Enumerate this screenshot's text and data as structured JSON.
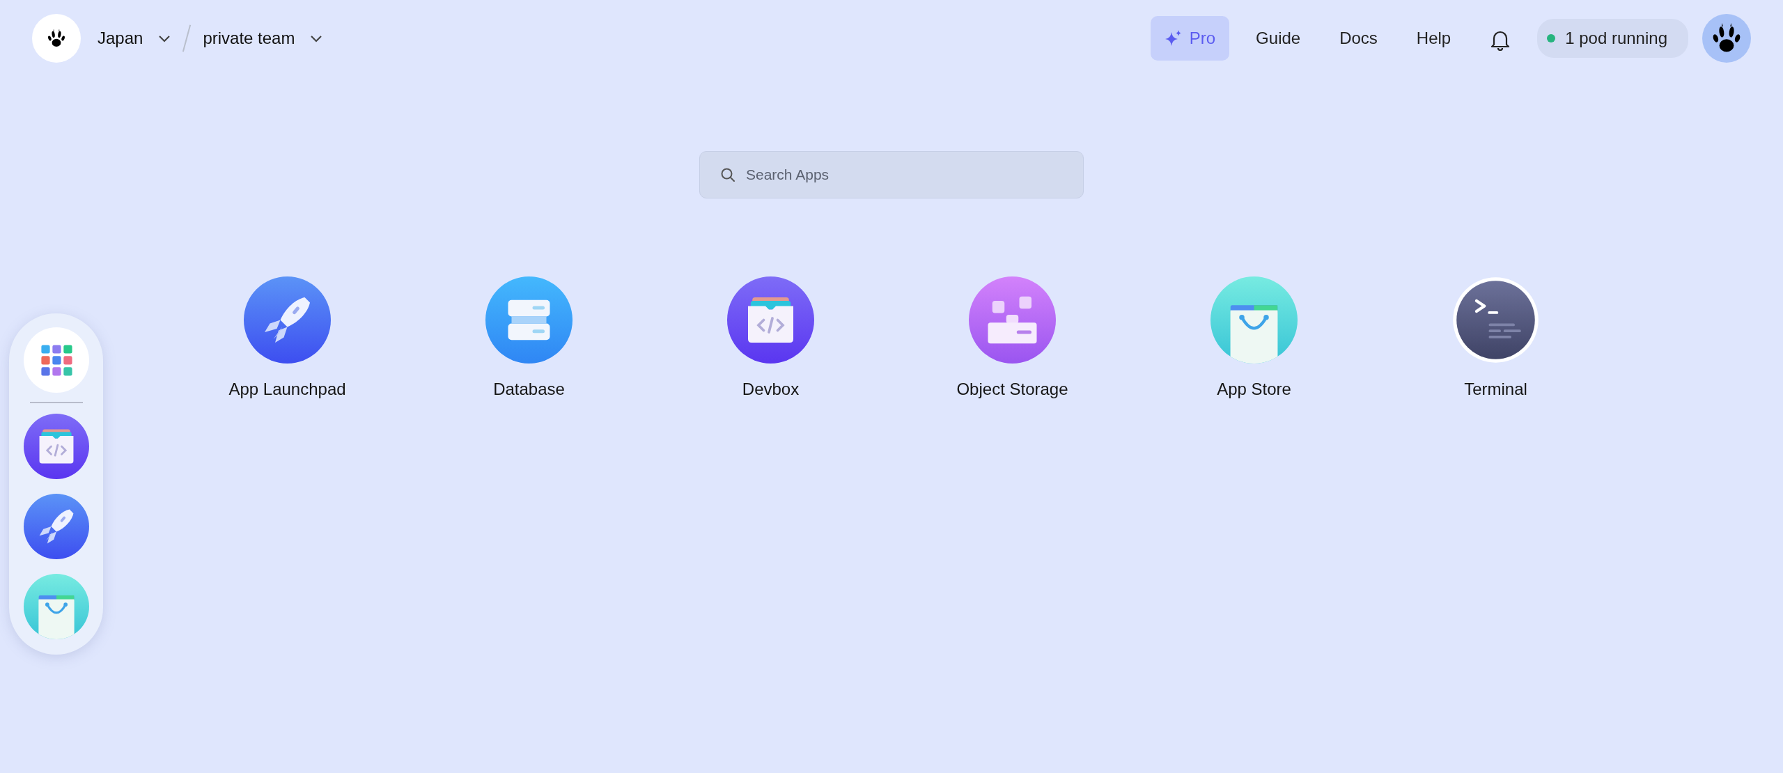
{
  "header": {
    "workspace": {
      "label": "Japan"
    },
    "team": {
      "label": "private team"
    }
  },
  "nav": [
    {
      "label": "Pro",
      "kind": "pro"
    },
    {
      "label": "Guide",
      "kind": "link"
    },
    {
      "label": "Docs",
      "kind": "link"
    },
    {
      "label": "Help",
      "kind": "link"
    }
  ],
  "pod_status": {
    "label": "1 pod running"
  },
  "search": {
    "placeholder": "Search Apps"
  },
  "apps": [
    {
      "label": "App Launchpad",
      "kind": "rocket"
    },
    {
      "label": "Database",
      "kind": "database"
    },
    {
      "label": "Devbox",
      "kind": "devbox"
    },
    {
      "label": "Object Storage",
      "kind": "storage"
    },
    {
      "label": "App Store",
      "kind": "store"
    },
    {
      "label": "Terminal",
      "kind": "terminal"
    }
  ],
  "dock": [
    {
      "kind": "grid"
    },
    {
      "kind": "devbox"
    },
    {
      "kind": "rocket"
    },
    {
      "kind": "store"
    }
  ]
}
